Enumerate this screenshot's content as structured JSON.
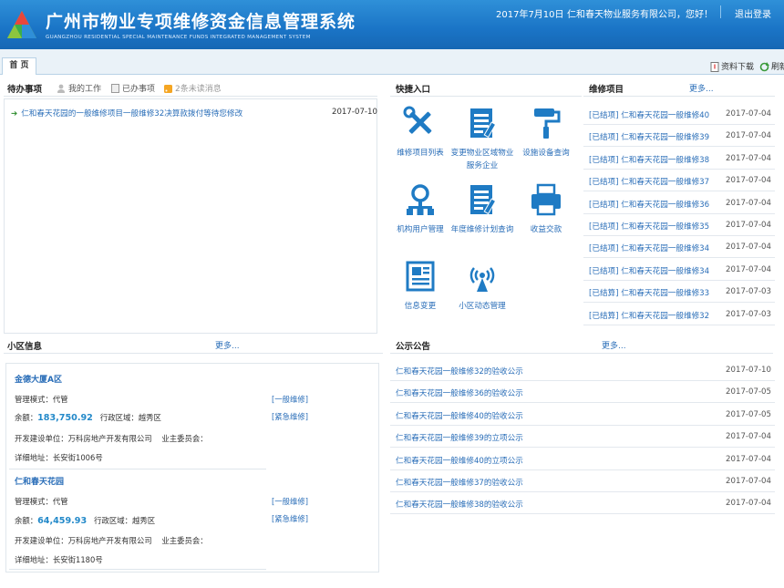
{
  "header": {
    "title": "广州市物业专项维修资金信息管理系统",
    "subtitle": "GUANGZHOU RESIDENTIAL SPECIAL MAINTENANCE FUNDS INTEGRATED MANAGEMENT SYSTEM",
    "date": "2017年7月10日",
    "greeting": "仁和春天物业服务有限公司，您好！",
    "logout": "退出登录"
  },
  "tabs": {
    "home": "首 页",
    "download": "资料下载",
    "refresh": "刷新"
  },
  "todo": {
    "title": "待办事项",
    "my_work": "我的工作",
    "done": "已办事项",
    "unread": "2条未读消息",
    "items": [
      {
        "text": "仁和春天花园的一般维修项目一般维修32决算款拨付等待您修改",
        "date": "2017-07-10"
      }
    ]
  },
  "quick": {
    "title": "快捷入口",
    "items": [
      {
        "label": "维修项目列表",
        "icon": "tools-icon"
      },
      {
        "label": "变更物业区域物业服务企业",
        "icon": "document-edit-icon"
      },
      {
        "label": "设施设备查询",
        "icon": "paint-roller-icon"
      },
      {
        "label": "机构用户管理",
        "icon": "org-user-icon"
      },
      {
        "label": "年度维修计划查询",
        "icon": "plan-edit-icon"
      },
      {
        "label": "收益交款",
        "icon": "printer-icon"
      },
      {
        "label": "信息变更",
        "icon": "newspaper-icon"
      },
      {
        "label": "小区动态管理",
        "icon": "signal-tower-icon"
      }
    ]
  },
  "projects": {
    "title": "维修项目",
    "more": "更多...",
    "items": [
      {
        "text": "[已结项] 仁和春天花园一般维修40",
        "date": "2017-07-04"
      },
      {
        "text": "[已结项] 仁和春天花园一般维修39",
        "date": "2017-07-04"
      },
      {
        "text": "[已结项] 仁和春天花园一般维修38",
        "date": "2017-07-04"
      },
      {
        "text": "[已结项] 仁和春天花园一般维修37",
        "date": "2017-07-04"
      },
      {
        "text": "[已结项] 仁和春天花园一般维修36",
        "date": "2017-07-04"
      },
      {
        "text": "[已结项] 仁和春天花园一般维修35",
        "date": "2017-07-04"
      },
      {
        "text": "[已结项] 仁和春天花园一般维修34",
        "date": "2017-07-04"
      },
      {
        "text": "[已结项] 仁和春天花园一般维修34",
        "date": "2017-07-04"
      },
      {
        "text": "[已结算] 仁和春天花园一般维修33",
        "date": "2017-07-03"
      },
      {
        "text": "[已结算] 仁和春天花园一般维修32",
        "date": "2017-07-03"
      }
    ]
  },
  "community": {
    "title": "小区信息",
    "more": "更多...",
    "items": [
      {
        "name": "金德大厦A区",
        "mode": "管理模式：代管",
        "balance_label": "余额：",
        "balance": "183,750.92",
        "district": "行政区域：越秀区",
        "developer": "开发建设单位：万科房地产开发有限公司",
        "committee": "业主委员会：",
        "address": "详细地址：长安街1006号",
        "link1": "[一般维修]",
        "link2": "[紧急维修]"
      },
      {
        "name": "仁和春天花园",
        "mode": "管理模式：代管",
        "balance_label": "余额：",
        "balance": "64,459.93",
        "district": "行政区域：越秀区",
        "developer": "开发建设单位：万科房地产开发有限公司",
        "committee": "业主委员会：",
        "address": "详细地址：长安街1180号",
        "link1": "[一般维修]",
        "link2": "[紧急维修]"
      }
    ]
  },
  "notices": {
    "title": "公示公告",
    "more": "更多...",
    "items": [
      {
        "text": "仁和春天花园一般维修32的验收公示",
        "date": "2017-07-10"
      },
      {
        "text": "仁和春天花园一般维修36的验收公示",
        "date": "2017-07-05"
      },
      {
        "text": "仁和春天花园一般维修40的验收公示",
        "date": "2017-07-05"
      },
      {
        "text": "仁和春天花园一般维修39的立项公示",
        "date": "2017-07-04"
      },
      {
        "text": "仁和春天花园一般维修40的立项公示",
        "date": "2017-07-04"
      },
      {
        "text": "仁和春天花园一般维修37的验收公示",
        "date": "2017-07-04"
      },
      {
        "text": "仁和春天花园一般维修38的验收公示",
        "date": "2017-07-04"
      }
    ]
  },
  "colors": {
    "header": "#1a74c6",
    "link": "#2a6eb8",
    "amount": "#2389c9"
  }
}
